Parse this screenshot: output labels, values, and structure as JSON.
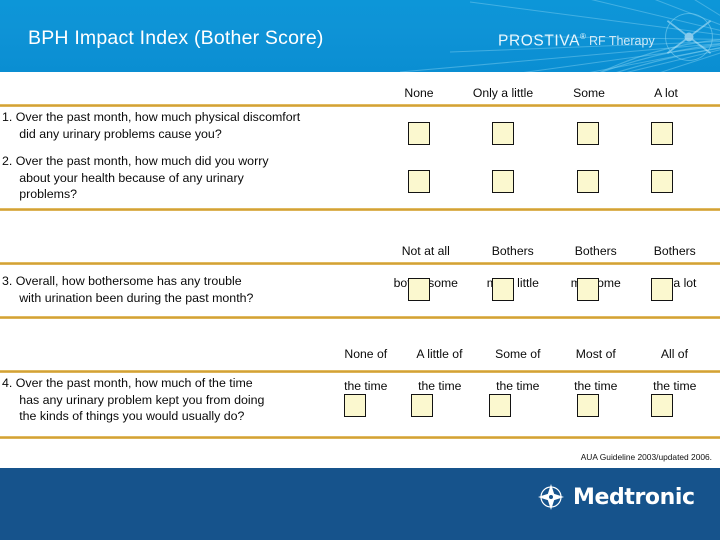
{
  "header": {
    "title": "BPH Impact Index (Bother Score)",
    "brand_name": "PROSTIVA",
    "brand_registered": "®",
    "brand_sub": "RF Therapy",
    "brand_color": "#0d96d8"
  },
  "column_groups": [
    {
      "id": "group-1",
      "options": [
        {
          "line1": "None",
          "line2": ""
        },
        {
          "line1": "Only a little",
          "line2": ""
        },
        {
          "line1": "Some",
          "line2": ""
        },
        {
          "line1": "A lot",
          "line2": ""
        }
      ]
    },
    {
      "id": "group-2",
      "options": [
        {
          "line1": "Not at all",
          "line2": "bothersome"
        },
        {
          "line1": "Bothers",
          "line2": "me a little"
        },
        {
          "line1": "Bothers",
          "line2": "me some"
        },
        {
          "line1": "Bothers",
          "line2": "me a lot"
        }
      ]
    },
    {
      "id": "group-3",
      "options": [
        {
          "line1": "None of",
          "line2": "the time"
        },
        {
          "line1": "A little of",
          "line2": "the time"
        },
        {
          "line1": "Some of",
          "line2": "the time"
        },
        {
          "line1": "Most of",
          "line2": "the time"
        },
        {
          "line1": "All of",
          "line2": "the time"
        }
      ]
    }
  ],
  "questions": [
    {
      "number": "1.",
      "text": "1. Over the past month, how much physical discomfort\n     did any urinary problems cause you?",
      "answer_count": 4
    },
    {
      "number": "2.",
      "text": "2. Over the past month, how much did you worry\n     about your health because of any urinary\n     problems?",
      "answer_count": 4
    },
    {
      "number": "3.",
      "text": "3. Overall, how bothersome has any trouble\n     with urination been during the past month?",
      "answer_count": 4
    },
    {
      "number": "4.",
      "text": "4. Over the past month, how much of the time\n     has any urinary problem kept you from doing\n     the kinds of things you would usually do?",
      "answer_count": 5
    }
  ],
  "credit": "AUA Guideline 2003/updated 2006.",
  "footer": {
    "company": "Medtronic",
    "background_color": "#16538c"
  },
  "colors": {
    "rule": "#cf9a2b",
    "answer_box_fill": "#fbf8cf",
    "answer_box_border": "#131313"
  }
}
